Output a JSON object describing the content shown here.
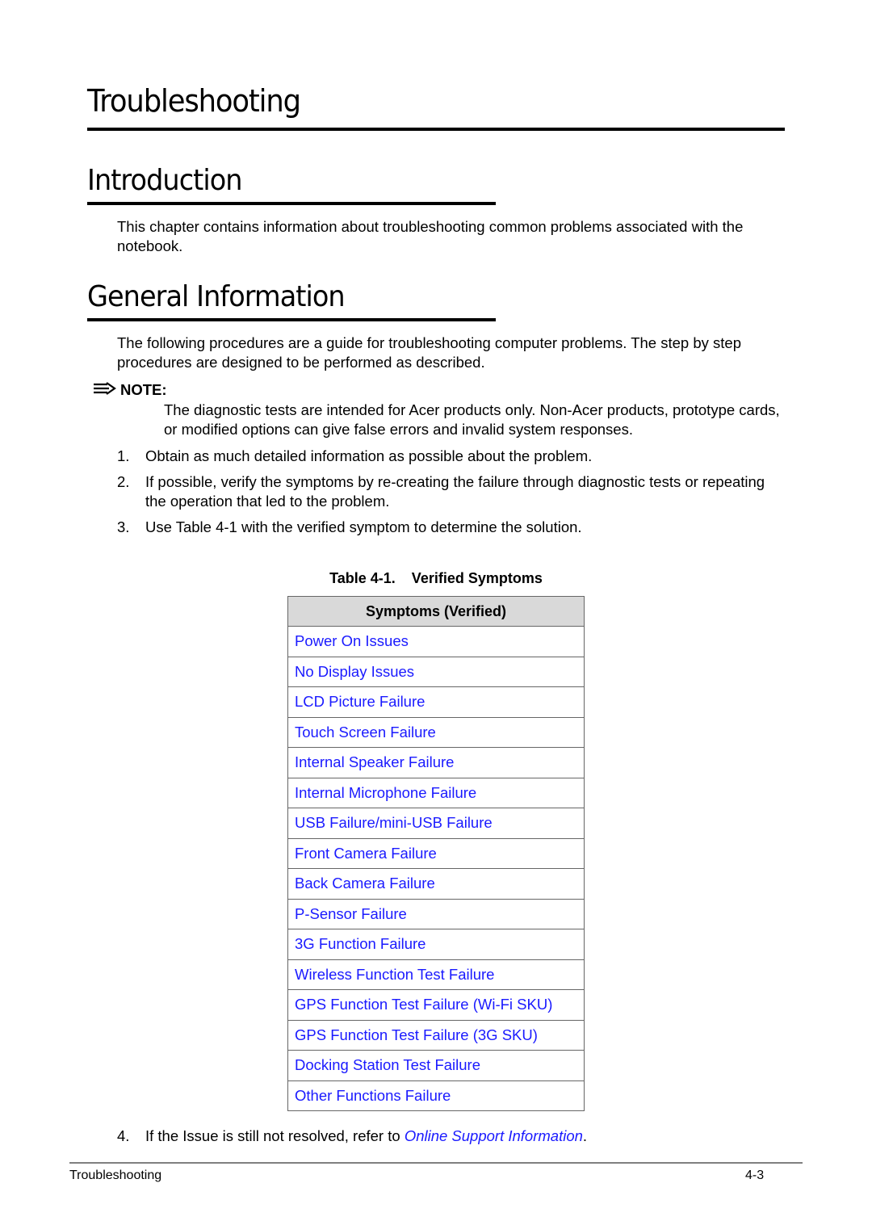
{
  "chapter_title": "Troubleshooting",
  "sections": {
    "introduction": {
      "heading": "Introduction",
      "body": "This chapter contains information about troubleshooting common problems associated with the notebook."
    },
    "general_information": {
      "heading": "General Information",
      "body": "The following procedures are a guide for troubleshooting computer problems. The step by step procedures are designed to be performed as described."
    }
  },
  "note": {
    "icon": "arrow-right-icon",
    "label": "NOTE:",
    "body": "The diagnostic tests are intended for Acer products only. Non-Acer products, prototype cards, or modified options can give false errors and invalid system responses."
  },
  "steps": [
    {
      "num": "1.",
      "text": "Obtain as much detailed information as possible about the problem."
    },
    {
      "num": "2.",
      "text": "If possible, verify the symptoms by re-creating the failure through diagnostic tests or repeating the operation that led to the problem."
    },
    {
      "num": "3.",
      "text": "Use Table 4-1 with the verified symptom to determine the solution."
    }
  ],
  "table": {
    "caption": "Table 4-1.    Verified Symptoms",
    "header": "Symptoms (Verified)",
    "rows": [
      "Power On Issues",
      "No Display Issues",
      "LCD Picture Failure",
      "Touch Screen Failure",
      "Internal Speaker Failure",
      "Internal Microphone Failure",
      "USB Failure/mini-USB Failure",
      "Front Camera Failure",
      "Back Camera Failure",
      "P-Sensor Failure",
      "3G Function Failure",
      "Wireless Function Test Failure",
      "GPS Function Test Failure (Wi-Fi SKU)",
      "GPS Function Test Failure (3G SKU)",
      "Docking Station Test Failure",
      "Other Functions Failure"
    ]
  },
  "step4": {
    "num": "4.",
    "text_before": "If the Issue is still not resolved, refer to ",
    "link": "Online Support Information",
    "text_after": "."
  },
  "footer": {
    "left": "Troubleshooting",
    "right": "4-3"
  },
  "colors": {
    "link": "#1a1aff",
    "table_header_bg": "#d9d9d9"
  }
}
